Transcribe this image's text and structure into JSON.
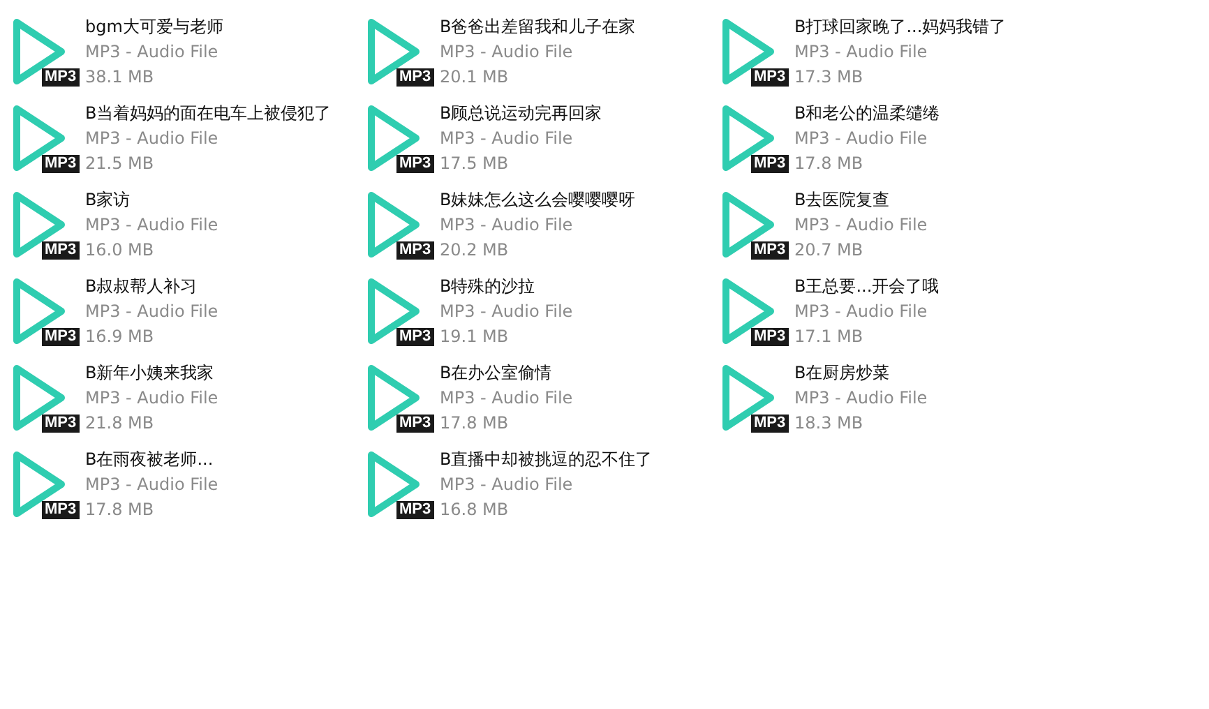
{
  "files": [
    {
      "name": "bgm大可爱与老师",
      "type": "MP3 - Audio File",
      "size": "38.1 MB",
      "badge": "MP3"
    },
    {
      "name": "B爸爸出差留我和儿子在家",
      "type": "MP3 - Audio File",
      "size": "20.1 MB",
      "badge": "MP3"
    },
    {
      "name": "B打球回家晚了...妈妈我错了",
      "type": "MP3 - Audio File",
      "size": "17.3 MB",
      "badge": "MP3"
    },
    {
      "name": "B当着妈妈的面在电车上被侵犯了",
      "type": "MP3 - Audio File",
      "size": "21.5 MB",
      "badge": "MP3"
    },
    {
      "name": "B顾总说运动完再回家",
      "type": "MP3 - Audio File",
      "size": "17.5 MB",
      "badge": "MP3"
    },
    {
      "name": "B和老公的温柔缱绻",
      "type": "MP3 - Audio File",
      "size": "17.8 MB",
      "badge": "MP3"
    },
    {
      "name": "B家访",
      "type": "MP3 - Audio File",
      "size": "16.0 MB",
      "badge": "MP3"
    },
    {
      "name": "B妹妹怎么这么会嘤嘤嘤呀",
      "type": "MP3 - Audio File",
      "size": "20.2 MB",
      "badge": "MP3"
    },
    {
      "name": "B去医院复查",
      "type": "MP3 - Audio File",
      "size": "20.7 MB",
      "badge": "MP3"
    },
    {
      "name": "B叔叔帮人补习",
      "type": "MP3 - Audio File",
      "size": "16.9 MB",
      "badge": "MP3"
    },
    {
      "name": "B特殊的沙拉",
      "type": "MP3 - Audio File",
      "size": "19.1 MB",
      "badge": "MP3"
    },
    {
      "name": "B王总要...开会了哦",
      "type": "MP3 - Audio File",
      "size": "17.1 MB",
      "badge": "MP3"
    },
    {
      "name": "B新年小姨来我家",
      "type": "MP3 - Audio File",
      "size": "21.8 MB",
      "badge": "MP3"
    },
    {
      "name": "B在办公室偷情",
      "type": "MP3 - Audio File",
      "size": "17.8 MB",
      "badge": "MP3"
    },
    {
      "name": "B在厨房炒菜",
      "type": "MP3 - Audio File",
      "size": "18.3 MB",
      "badge": "MP3"
    },
    {
      "name": "B在雨夜被老师...",
      "type": "MP3 - Audio File",
      "size": "17.8 MB",
      "badge": "MP3"
    },
    {
      "name": "B直播中却被挑逗的忍不住了",
      "type": "MP3 - Audio File",
      "size": "16.8 MB",
      "badge": "MP3"
    }
  ]
}
